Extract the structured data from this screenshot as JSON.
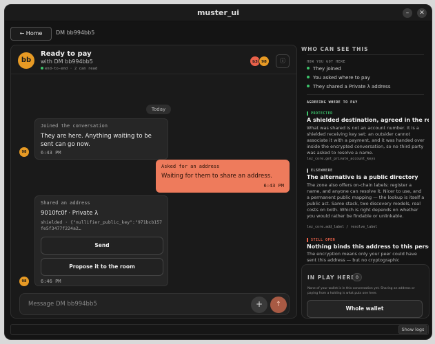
{
  "window": {
    "title": "muster_ui",
    "minimize_glyph": "–",
    "close_glyph": "✕"
  },
  "topbar": {
    "home_label": "← Home",
    "breadcrumb": "DM bb994bb5"
  },
  "chat": {
    "avatar_initials": "bb",
    "title": "Ready to pay",
    "subtitle": "with DM bb994bb5",
    "encryption_note": "end-to-end · 2 can read",
    "participants": [
      {
        "initials": "b3",
        "color": "#e9614a"
      },
      {
        "initials": "98",
        "color": "#e79a24"
      }
    ],
    "info_icon": "info-icon",
    "day_separator": "Today",
    "messages": [
      {
        "label": "Joined the conversation",
        "body": "They are here. Anything waiting to be sent can go now.",
        "time": "6:43 PM",
        "sender": "98"
      },
      {
        "label": "Asked for an address",
        "body": "Waiting for them to share an address.",
        "time": "6:43 PM"
      },
      {
        "label": "Shared an address",
        "body": "9010fc0f · Private λ",
        "detail": "shielded · {\"nullifier_public_key\":\"971bcb157fe5f3477f224a2…",
        "send_label": "Send",
        "propose_label": "Propose it to the room",
        "time": "6:46 PM",
        "sender": "98"
      }
    ],
    "composer": {
      "placeholder": "Message DM bb994bb5",
      "plus_glyph": "+",
      "send_glyph": "↑"
    }
  },
  "sidebar": {
    "heading": "WHO CAN SEE THIS",
    "how_label": "HOW YOU GOT HERE",
    "steps": [
      "They joined",
      "You asked where to pay",
      "They shared a Private λ address"
    ],
    "agreeing_label": "AGREEING WHERE TO PAY",
    "options": [
      {
        "tag": "PROTECTED",
        "tag_color": "#3cc46b",
        "title": "A shielded destination, agreed in the room",
        "body": "What was shared is not an account number. It is a shielded receiving key set: an outsider cannot associate it with a payment, and it was handed over inside the encrypted conversation, so no third party was asked to resolve a name.",
        "code": "lez_core.get_private_account_keys"
      },
      {
        "tag": "ELSEWHERE",
        "tag_color": "#bbbbbb",
        "title": "The alternative is a public directory",
        "body": "The zone also offers on-chain labels: register a name, and anyone can resolve it. Nicer to use, and a permanent public mapping — the lookup is itself a public act. Same stack, two discovery models, real costs on both. Which is right depends on whether you would rather be findable or unlinkable.",
        "code": "lez_core.add_label / resolve_label"
      },
      {
        "tag": "STILL OPEN",
        "tag_color": "#e9614a",
        "title": "Nothing binds this address to this person",
        "body": "The encryption means only your peer could have sent this address — but no cryptographic"
      }
    ]
  },
  "in_play": {
    "heading": "IN PLAY HERE",
    "count": "0",
    "note": "None of your wallet is in this conversation yet. Sharing an address or paying from a holding is what puts one here.",
    "button_label": "Whole wallet"
  },
  "statusbar": {
    "logs_label": "Show logs"
  }
}
